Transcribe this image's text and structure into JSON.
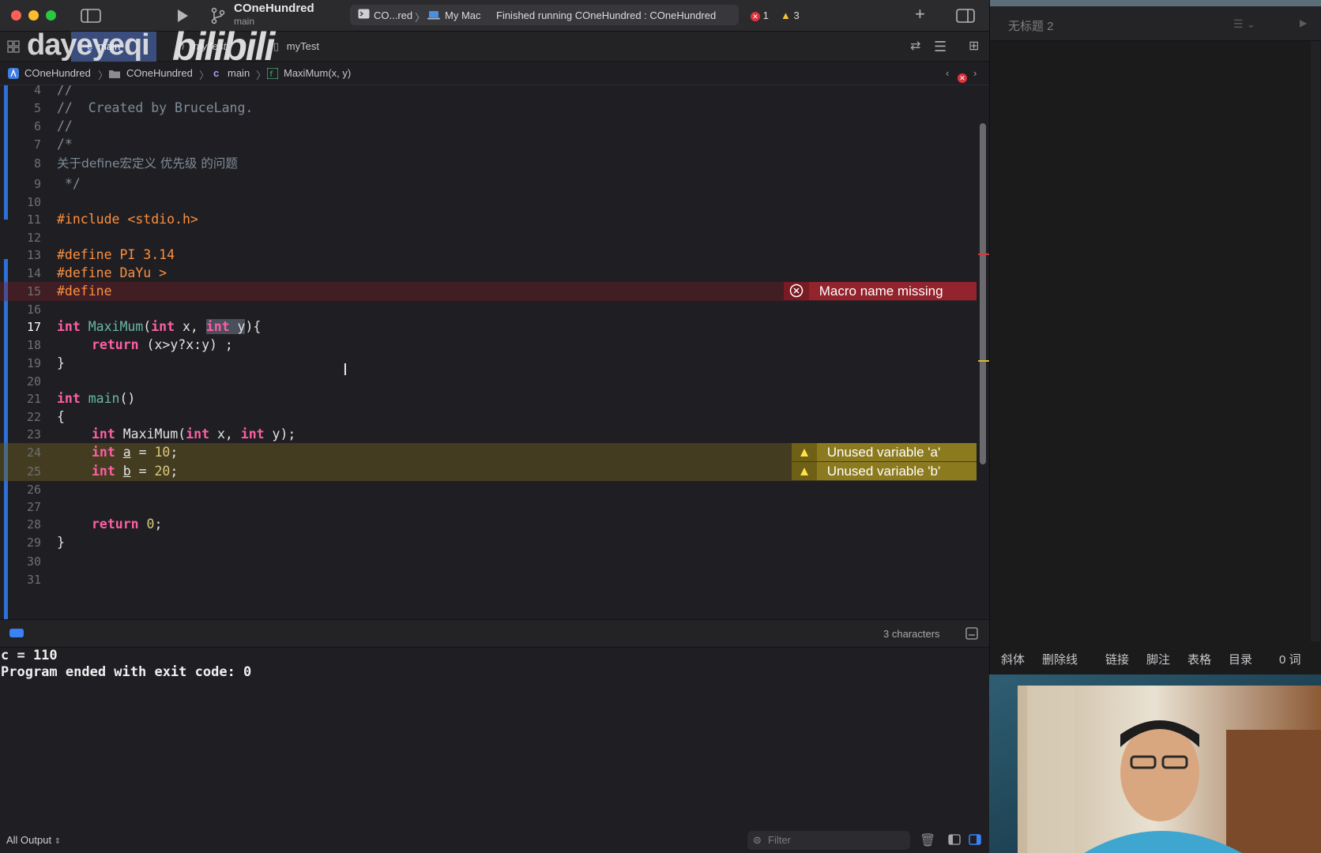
{
  "xcode": {
    "project_title": "COneHundred",
    "branch": "main",
    "status": {
      "scheme": "CO...red",
      "destination": "My Mac",
      "message": "Finished running COneHundred : COneHundred",
      "error_count": "1",
      "warning_count": "3"
    },
    "tabs": [
      {
        "label": "main"
      },
      {
        "label": "myTest"
      },
      {
        "label": "myTest"
      }
    ],
    "watermark": {
      "text": "dayeyeqi",
      "brand": "bilibili"
    },
    "breadcrumb": [
      "COneHundred",
      "COneHundred",
      "main",
      "MaxiMum(x, y)"
    ],
    "editor": {
      "lines": [
        {
          "n": "4"
        },
        {
          "n": "5"
        },
        {
          "n": "6"
        },
        {
          "n": "7"
        },
        {
          "n": "8"
        },
        {
          "n": "9"
        },
        {
          "n": "10"
        },
        {
          "n": "11"
        },
        {
          "n": "12"
        },
        {
          "n": "13"
        },
        {
          "n": "14"
        },
        {
          "n": "15"
        },
        {
          "n": "16"
        },
        {
          "n": "17"
        },
        {
          "n": "18"
        },
        {
          "n": "19"
        },
        {
          "n": "20"
        },
        {
          "n": "21"
        },
        {
          "n": "22"
        },
        {
          "n": "23"
        },
        {
          "n": "24"
        },
        {
          "n": "25"
        },
        {
          "n": "26"
        },
        {
          "n": "27"
        },
        {
          "n": "28"
        },
        {
          "n": "29"
        },
        {
          "n": "30"
        },
        {
          "n": "31"
        }
      ],
      "code": {
        "l4": "//",
        "l5": "//  Created by BruceLang.",
        "l6": "//",
        "l7": "/*",
        "l8": "关于define宏定义 优先级 的问题",
        "l9": " */",
        "l11_a": "#include ",
        "l11_b": "<stdio.h>",
        "l13": "#define PI 3.14",
        "l14": "#define DaYu >",
        "l15": "#define",
        "l17_int1": "int",
        "l17_fn": "MaxiMum",
        "l17_p1": "(",
        "l17_int2": "int",
        "l17_p2": " x, ",
        "l17_int3": "int",
        "l17_p3": " y",
        "l17_p4": "){",
        "l18_kw": "return",
        "l18_rest": " (x>y?x:y) ;",
        "l19": "}",
        "l21_kw": "int",
        "l21_fn": "main",
        "l21_rest": "()",
        "l22": "{",
        "l23_int1": "int",
        "l23_fn": " MaxiMum(",
        "l23_int2": "int",
        "l23_mid": " x, ",
        "l23_int3": "int",
        "l23_end": " y);",
        "l24_kw": "int",
        "l24_var": "a",
        "l24_eq": " = ",
        "l24_num": "10",
        "l24_end": ";",
        "l25_kw": "int",
        "l25_var": "b",
        "l25_eq": " = ",
        "l25_num": "20",
        "l25_end": ";",
        "l28_kw": "return",
        "l28_num": "0",
        "l28_end": ";",
        "l29": "}"
      },
      "diagnostics": {
        "error_line15": "Macro name missing",
        "warning_line24": "Unused variable 'a'",
        "warning_line25": "Unused variable 'b'"
      }
    },
    "editor_status": {
      "selection": "3 characters"
    },
    "console": {
      "lines": [
        "c = 110",
        "Program ended with exit code: 0"
      ],
      "output_selector": "All Output",
      "filter_placeholder": "Filter"
    }
  },
  "right_app": {
    "title": "无标题 2",
    "toolbar": [
      "斜体",
      "删除线",
      "链接",
      "脚注",
      "表格",
      "目录",
      "0 词"
    ]
  },
  "colors": {
    "keyword": "#fc5fa3",
    "preprocessor": "#fd8f3f",
    "comment": "#7f8c98",
    "error_banner": "#93232c",
    "warning_banner": "#8c7a1f",
    "selected_tab": "#3a4d7c",
    "gutter_change": "#2d6fd6"
  }
}
